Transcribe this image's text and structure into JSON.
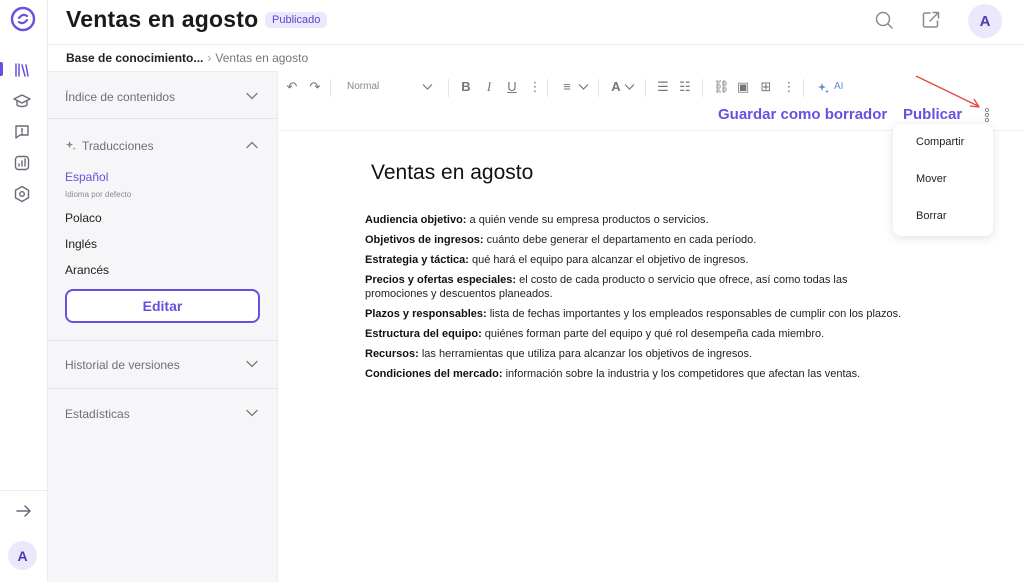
{
  "header": {
    "title": "Ventas en agosto",
    "status_badge": "Publicado",
    "avatar_initial": "A"
  },
  "rail": {
    "items": [
      "logo-icon",
      "library-icon",
      "graduation-icon",
      "feedback-icon",
      "analytics-icon",
      "settings-icon"
    ],
    "expand_icon": "arrow-right-icon",
    "avatar_initial": "A"
  },
  "breadcrumb": {
    "root": "Base de conocimiento...",
    "separator": "›",
    "current": "Ventas en agosto"
  },
  "sidebar": {
    "toc_label": "Índice de contenidos",
    "translations_label": "Traducciones",
    "languages": [
      {
        "name": "Español",
        "sub": "Idioma por defecto"
      },
      {
        "name": "Polaco"
      },
      {
        "name": "Inglés"
      },
      {
        "name": "Arancés"
      }
    ],
    "edit_button": "Editar",
    "history_label": "Historial de versiones",
    "stats_label": "Estadísticas"
  },
  "toolbar": {
    "text_style": "Normal",
    "ai_label": "AI"
  },
  "actions": {
    "save_draft": "Guardar como borrador",
    "publish": "Publicar"
  },
  "menu": {
    "items": [
      "Compartir",
      "Mover",
      "Borrar"
    ]
  },
  "document": {
    "title": "Ventas en agosto",
    "paragraphs": [
      {
        "label": "Audiencia objetivo:",
        "text": " a quién vende su empresa productos o servicios."
      },
      {
        "label": "Objetivos de ingresos:",
        "text": " cuánto debe generar el departamento en cada período."
      },
      {
        "label": "Estrategia y táctica:",
        "text": " qué hará el equipo para alcanzar el objetivo de ingresos."
      },
      {
        "label": "Precios y ofertas especiales:",
        "text": " el costo de cada producto o servicio que ofrece, así como todas las promociones y descuentos planeados."
      },
      {
        "label": "Plazos y responsables:",
        "text": " lista de fechas importantes y los empleados responsables de cumplir con los plazos."
      },
      {
        "label": "Estructura del equipo:",
        "text": " quiénes forman parte del equipo y qué rol desempeña cada miembro."
      },
      {
        "label": "Recursos:",
        "text": " las herramientas que utiliza para alcanzar los objetivos de ingresos."
      },
      {
        "label": "Condiciones del mercado:",
        "text": " información sobre la industria y los competidores que afectan las ventas."
      }
    ]
  },
  "colors": {
    "accent": "#6b4fe0",
    "badge_bg": "#ebe8fb",
    "annotation_arrow": "#e8453c"
  }
}
